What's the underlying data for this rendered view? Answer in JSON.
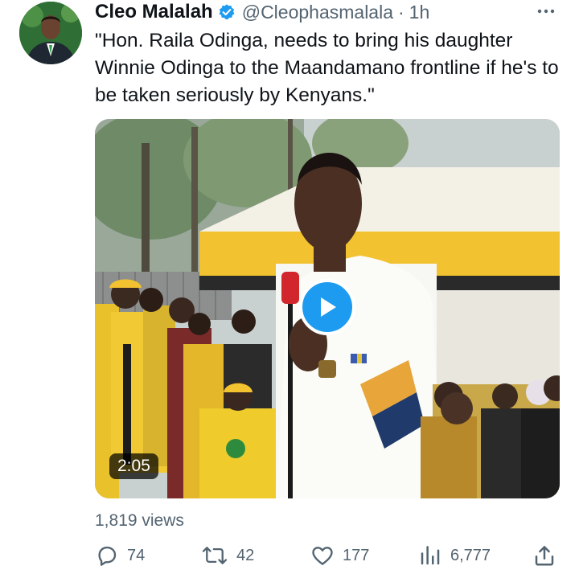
{
  "tweet": {
    "author_name": "Cleo Malalah",
    "verified_icon": "verified-badge-icon",
    "handle": "@Cleophasmalala",
    "separator": "·",
    "time": "1h",
    "more_icon": "more-options-icon",
    "text": "\"Hon. Raila Odinga, needs to bring his daughter Winnie Odinga to the Maandamano frontline if he's to be taken seriously by Kenyans.\"",
    "video": {
      "duration": "2:05",
      "play_icon": "play-icon"
    },
    "views": "1,819 views",
    "actions": {
      "reply_count": "74",
      "retweet_count": "42",
      "like_count": "177",
      "analytics_count": "6,777"
    }
  },
  "colors": {
    "accent": "#1d9bf0",
    "secondary_text": "#536471",
    "primary_text": "#0f1419"
  }
}
